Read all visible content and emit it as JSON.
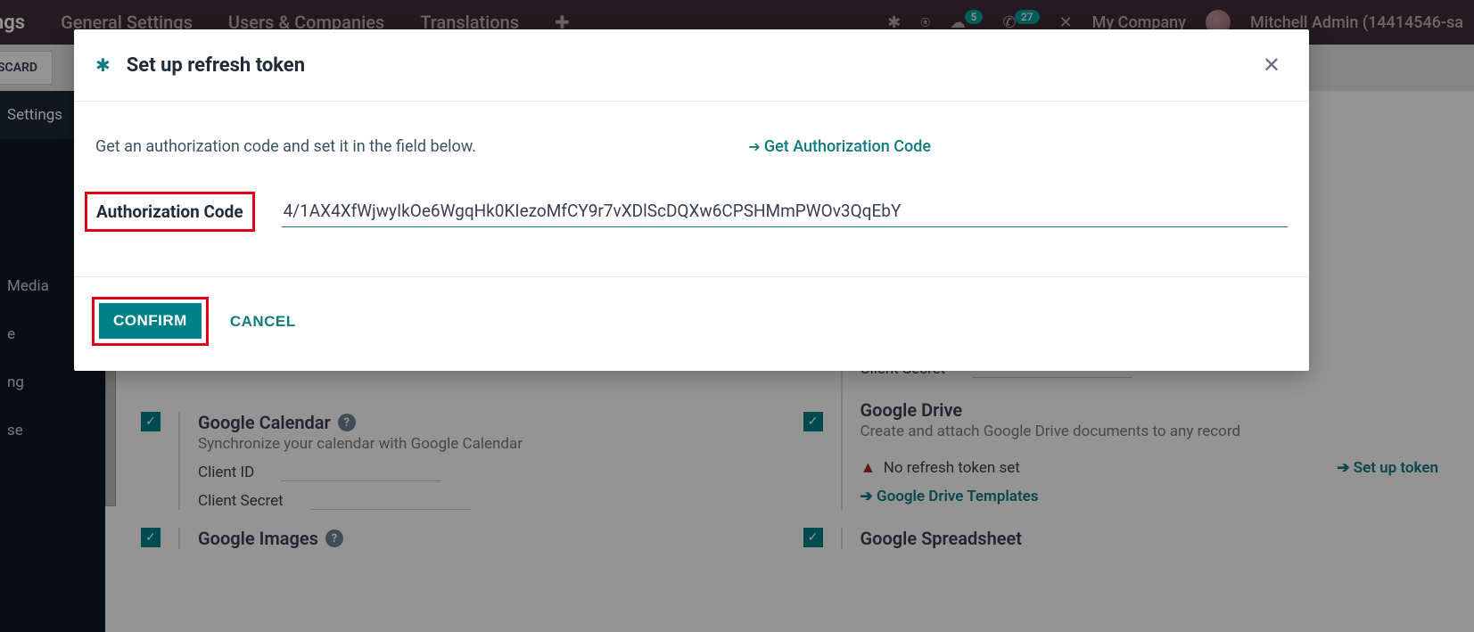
{
  "top": {
    "app_title_partial": "ngs",
    "menu": [
      "General Settings",
      "Users & Companies",
      "Translations"
    ],
    "badges": {
      "messages": "5",
      "activities": "27"
    },
    "company": "My Company",
    "user": "Mitchell Admin (14414546-sa"
  },
  "toolbar": {
    "discard": "SCARD"
  },
  "sidebar": {
    "items": [
      "Settings",
      "Media",
      "e",
      "ng",
      "se"
    ],
    "active_index": 0
  },
  "settings": {
    "gcal": {
      "title": "Google Calendar",
      "desc": "Synchronize your calendar with Google Calendar",
      "client_id_label": "Client ID",
      "client_secret_label": "Client Secret"
    },
    "gdrive": {
      "title": "Google Drive",
      "desc": "Create and attach Google Drive documents to any record",
      "client_secret_label": "Client Secret",
      "warn": "No refresh token set",
      "setup": "Set up token",
      "templates": "Google Drive Templates"
    },
    "gimg": {
      "title": "Google Images"
    },
    "gsheet": {
      "title": "Google Spreadsheet"
    }
  },
  "modal": {
    "title": "Set up refresh token",
    "instruction": "Get an authorization code and set it in the field below.",
    "get_link": "Get Authorization Code",
    "field_label": "Authorization Code",
    "field_value": "4/1AX4XfWjwyIkOe6WgqHk0KIezoMfCY9r7vXDlScDQXw6CPSHMmPWOv3QqEbY",
    "confirm": "CONFIRM",
    "cancel": "CANCEL"
  }
}
